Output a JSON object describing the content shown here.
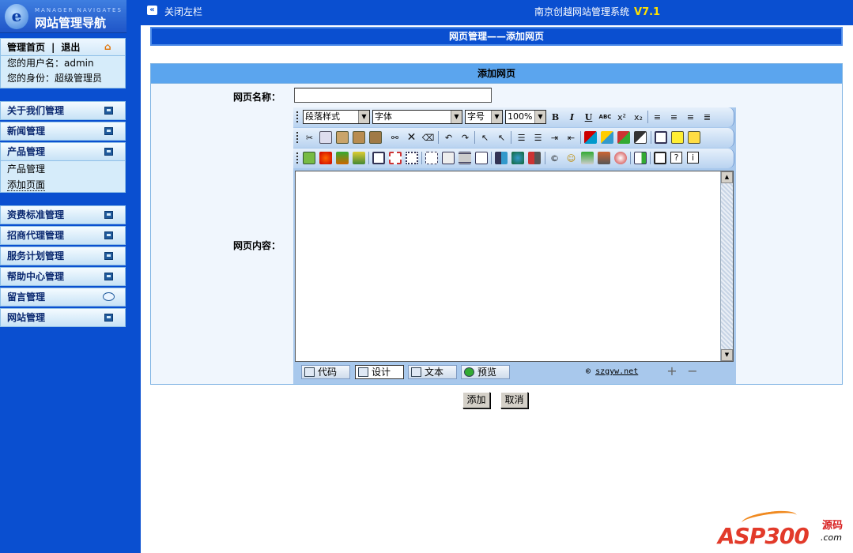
{
  "sidebar": {
    "logo": {
      "eng": "MANAGER NAVIGATES",
      "cn": "网站管理导航",
      "mark": "e"
    },
    "user": {
      "home": "管理首页",
      "sep": "|",
      "logout": "退出",
      "username": "您的用户名：admin",
      "role": "您的身份：超级管理员"
    },
    "menus": [
      "关于我们管理",
      "新闻管理",
      "产品管理",
      "资费标准管理",
      "招商代理管理",
      "服务计划管理",
      "帮助中心管理",
      "留言管理",
      "网站管理"
    ],
    "submenu": [
      "产品管理",
      "添加页面"
    ]
  },
  "topbar": {
    "close_icon": "«",
    "close_label": "关闭左栏",
    "title": "南京创越网站管理系统",
    "version": "V7.1"
  },
  "page": {
    "header": "网页管理——添加网页",
    "form_title": "添加网页",
    "name_label": "网页名称：",
    "name_value": "",
    "content_label": "网页内容："
  },
  "editor": {
    "style_select": "段落样式",
    "font_select": "字体",
    "size_select": "字号",
    "zoom_select": "100%",
    "bold": "B",
    "italic": "I",
    "underline": "U",
    "strike": "ABC",
    "modes": [
      "代码",
      "设计",
      "文本",
      "预览"
    ],
    "active_mode": "设计",
    "copyright_symbol": "©",
    "copyright_link": "szgyw.net",
    "zoom_in": "+",
    "zoom_out": "−"
  },
  "buttons": {
    "add": "添加",
    "cancel": "取消"
  },
  "watermark": {
    "logo": "ASP300",
    "cn": "源码",
    "domain": ".com"
  }
}
